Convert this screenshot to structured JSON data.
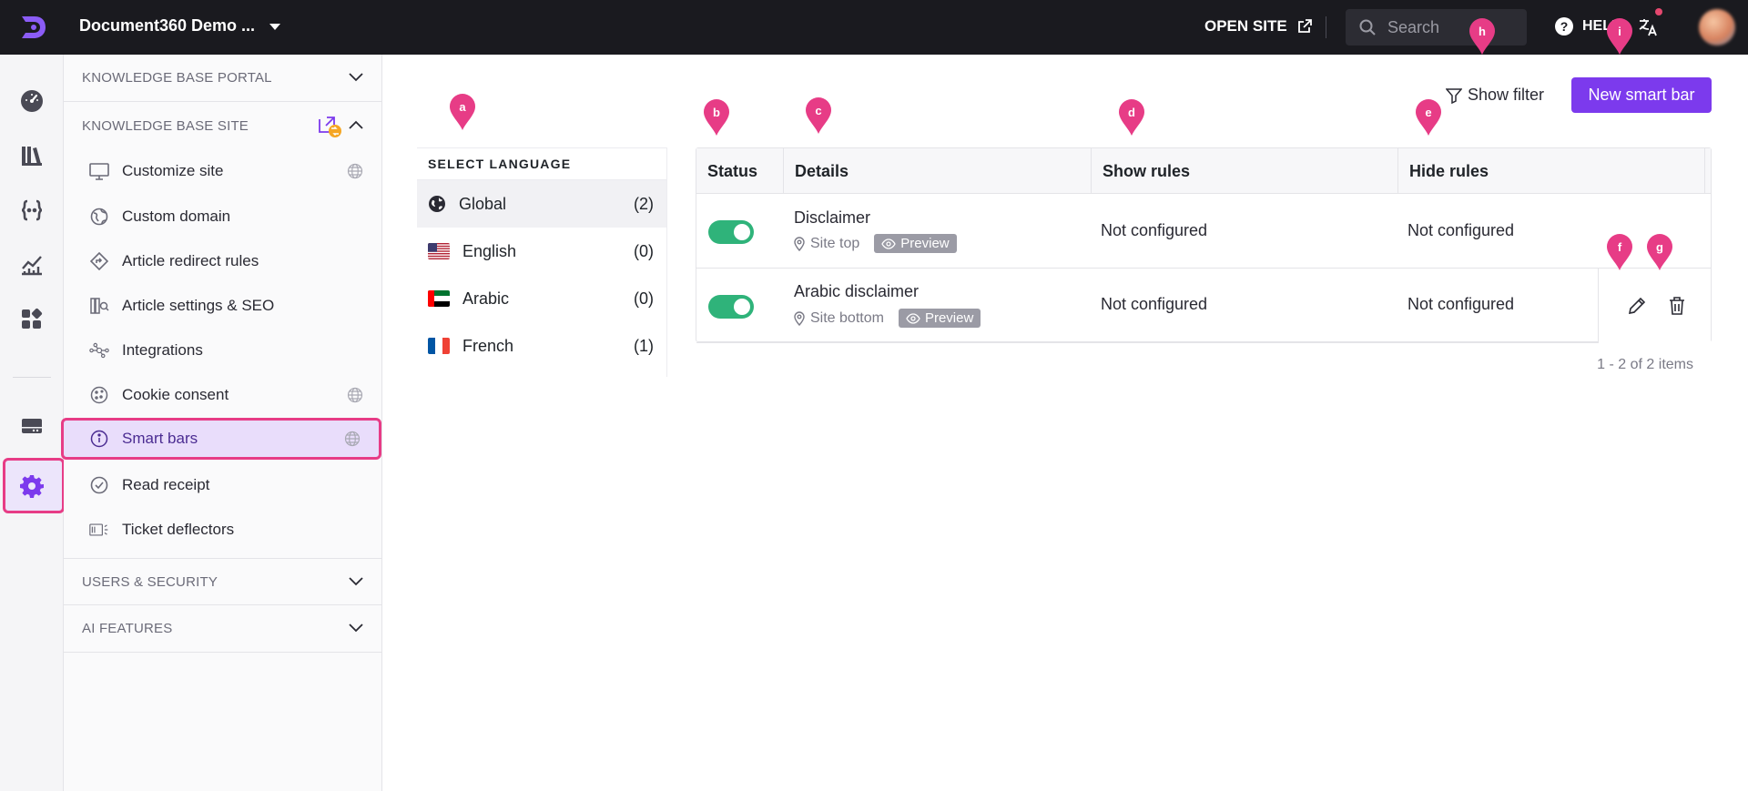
{
  "topbar": {
    "project_name": "Document360 Demo ...",
    "open_site_label": "OPEN SITE",
    "search_placeholder": "Search",
    "help_label": "HELP"
  },
  "rail": {
    "icons": [
      "dashboard-icon",
      "library-icon",
      "api-icon",
      "analytics-icon",
      "apps-icon",
      "drive-icon",
      "settings-icon"
    ],
    "active": "settings-icon"
  },
  "sidebar": {
    "sections": {
      "portal": "KNOWLEDGE BASE PORTAL",
      "site": "KNOWLEDGE BASE SITE",
      "users": "USERS & SECURITY",
      "ai": "AI FEATURES"
    },
    "items": [
      {
        "label": "Customize site",
        "icon": "monitor-icon",
        "globe": true
      },
      {
        "label": "Custom domain",
        "icon": "domain-icon",
        "globe": false
      },
      {
        "label": "Article redirect rules",
        "icon": "redirect-icon",
        "globe": false
      },
      {
        "label": "Article settings & SEO",
        "icon": "seo-icon",
        "globe": false
      },
      {
        "label": "Integrations",
        "icon": "integrations-icon",
        "globe": false
      },
      {
        "label": "Cookie consent",
        "icon": "cookie-icon",
        "globe": true
      },
      {
        "label": "Smart bars",
        "icon": "info-icon",
        "globe": true,
        "active": true
      },
      {
        "label": "Read receipt",
        "icon": "check-circle-icon",
        "globe": false
      },
      {
        "label": "Ticket deflectors",
        "icon": "ticket-icon",
        "globe": false
      }
    ]
  },
  "toolbar": {
    "show_filter_label": "Show filter",
    "new_button_label": "New smart bar"
  },
  "languages": {
    "heading": "SELECT LANGUAGE",
    "items": [
      {
        "name": "Global",
        "count": "(2)",
        "selected": true
      },
      {
        "name": "English",
        "count": "(0)"
      },
      {
        "name": "Arabic",
        "count": "(0)"
      },
      {
        "name": "French",
        "count": "(1)"
      }
    ]
  },
  "table": {
    "columns": [
      "Status",
      "Details",
      "Show rules",
      "Hide rules"
    ],
    "rows": [
      {
        "status": "on",
        "name": "Disclaimer",
        "location": "Site top",
        "preview": "Preview",
        "show_rules": "Not configured",
        "hide_rules": "Not configured"
      },
      {
        "status": "on",
        "name": "Arabic disclaimer",
        "location": "Site bottom",
        "preview": "Preview",
        "show_rules": "Not configured",
        "hide_rules": "Not configured"
      }
    ],
    "pager": "1 - 2 of 2 items"
  },
  "callouts": [
    "a",
    "b",
    "c",
    "d",
    "e",
    "f",
    "g",
    "h",
    "i"
  ],
  "colors": {
    "accent": "#7c3aed",
    "callout": "#e73c86",
    "toggle_on": "#2fb37a",
    "topbar": "#1a1a1f"
  }
}
